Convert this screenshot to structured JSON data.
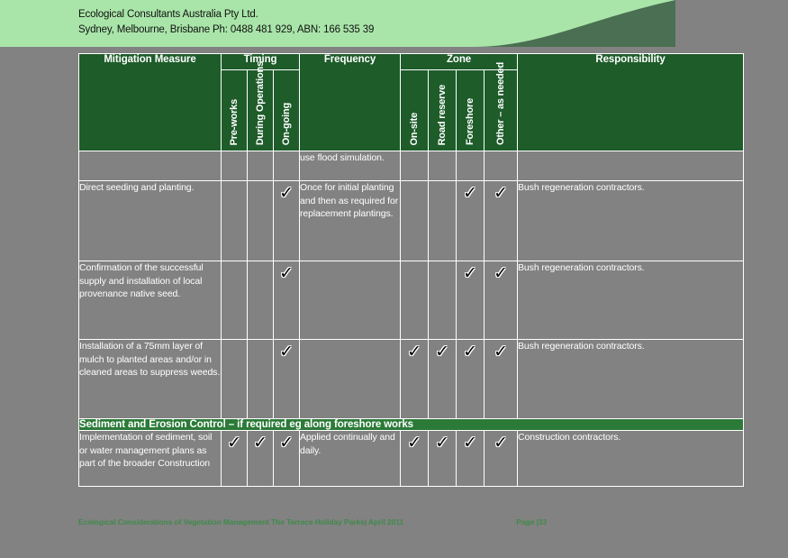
{
  "letterhead": {
    "line1": "Ecological Consultants Australia Pty Ltd.",
    "line2": "Sydney, Melbourne, Brisbane Ph: 0488 481 929, ABN: 166 535 39",
    "band_color": "#a9e5a9",
    "curve_color": "#4a6f52"
  },
  "table": {
    "header": {
      "mitigation_measure": "Mitigation Measure",
      "timing": "Timing",
      "frequency": "Frequency",
      "zone": "Zone",
      "responsibility": "Responsibility",
      "timing_cols": [
        "Pre-works",
        "During Operations",
        "On-going"
      ],
      "zone_cols": [
        "On-site",
        "Road reserve",
        "Foreshore",
        "Other – as needed"
      ],
      "bg_color": "#1e5c2a"
    },
    "check_glyph": "✓",
    "rows": [
      {
        "measure": "",
        "timing": [
          false,
          false,
          false
        ],
        "frequency": "use flood simulation.",
        "zone": [
          false,
          false,
          false,
          false
        ],
        "responsibility": "",
        "clipped_top": true
      },
      {
        "measure": "Direct seeding and planting.",
        "timing": [
          false,
          false,
          true
        ],
        "frequency": "Once for initial planting and then as required for replacement plantings.",
        "zone": [
          false,
          false,
          true,
          true
        ],
        "responsibility": "Bush regeneration contractors."
      },
      {
        "measure": "Confirmation of the successful supply and installation of local provenance native seed.",
        "timing": [
          false,
          false,
          true
        ],
        "frequency": "",
        "zone": [
          false,
          false,
          true,
          true
        ],
        "responsibility": "Bush regeneration contractors."
      },
      {
        "measure": "Installation of a 75mm layer of mulch to planted areas and/or in cleaned areas to suppress weeds.",
        "timing": [
          false,
          false,
          true
        ],
        "frequency": "",
        "zone": [
          true,
          true,
          true,
          true
        ],
        "responsibility": "Bush regeneration contractors."
      }
    ],
    "section_band": {
      "label": "Sediment and Erosion Control – if required eg along foreshore works",
      "bg_color": "#2b7a38"
    },
    "rows_after_band": [
      {
        "measure": "Implementation of sediment, soil or water management plans as part of the broader Construction",
        "timing": [
          true,
          true,
          true
        ],
        "frequency": "Applied continually and daily.",
        "zone": [
          true,
          true,
          true,
          true
        ],
        "responsibility": "Construction contractors.",
        "clipped_bottom": true
      }
    ]
  },
  "footer": {
    "document_title": "Ecological Considerations of Vegetation Management The Terrace Holiday Parks| April 2011",
    "page_label": "Page |33",
    "text_color": "#3f8a4a"
  }
}
